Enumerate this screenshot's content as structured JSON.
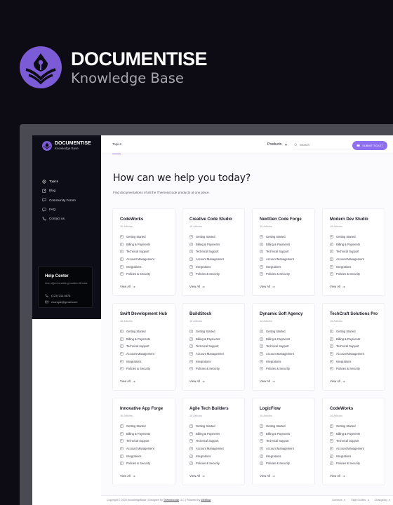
{
  "hero": {
    "title": "DOCUMENTISE",
    "subtitle": "Knowledge Base",
    "accent_color": "#7c5cd6"
  },
  "sidebar": {
    "brand_title": "DOCUMENTISE",
    "brand_subtitle": "Knowledge Base",
    "items": [
      {
        "label": "Topics",
        "icon": "gear-icon",
        "active": true
      },
      {
        "label": "Blog",
        "icon": "edit-icon",
        "active": false
      },
      {
        "label": "Community Forum",
        "icon": "chat-icon",
        "active": false
      },
      {
        "label": "FAQ",
        "icon": "faq-icon",
        "active": false
      },
      {
        "label": "Contact us",
        "icon": "phone-icon",
        "active": false
      }
    ],
    "help": {
      "title": "Help Center",
      "description": "Live object a setting location fill tabs",
      "phone": "(123) 234-5678",
      "email": "example@gmail.com"
    }
  },
  "header": {
    "breadcrumb": "Topics",
    "products_label": "Products",
    "search_placeholder": "Search",
    "submit_label": "SUBMIT TICKET"
  },
  "main": {
    "headline": "How can we help you today?",
    "subline": "Find documentations of all the Themeix/code products at one place.",
    "view_all_label": "View All",
    "link_labels": [
      "Getting Started",
      "Billing & Payments",
      "Technical Support",
      "Account Management",
      "Integrations",
      "Policies & Security"
    ],
    "cards": [
      {
        "title": "CodeWorks",
        "count": "16 Articles"
      },
      {
        "title": "Creative Code Studio",
        "count": "16 Articles"
      },
      {
        "title": "NextGen Code Forge",
        "count": "16 Articles"
      },
      {
        "title": "Modern Dev Studio",
        "count": "16 Articles"
      },
      {
        "title": "Swift Development Hub",
        "count": "16 Articles"
      },
      {
        "title": "BuildStock",
        "count": "16 Articles"
      },
      {
        "title": "Dynamic Soft Agency",
        "count": "16 Articles"
      },
      {
        "title": "TechCraft Solutions Pro",
        "count": "16 Articles"
      },
      {
        "title": "Innovative App Forge",
        "count": "16 Articles"
      },
      {
        "title": "Agile Tech Builders",
        "count": "16 Articles"
      },
      {
        "title": "LogicFlow",
        "count": "16 Articles"
      },
      {
        "title": "CodeWorks",
        "count": "16 Articles"
      }
    ]
  },
  "footer": {
    "copyright": "Copyright © 2025 KnowledgeBase | Designed by ",
    "designer": "Themeixcode",
    "mid": " LLC | Powered by ",
    "powered": "Webflow",
    "links": [
      "Licenses",
      "Style Guides",
      "Changelog"
    ]
  }
}
